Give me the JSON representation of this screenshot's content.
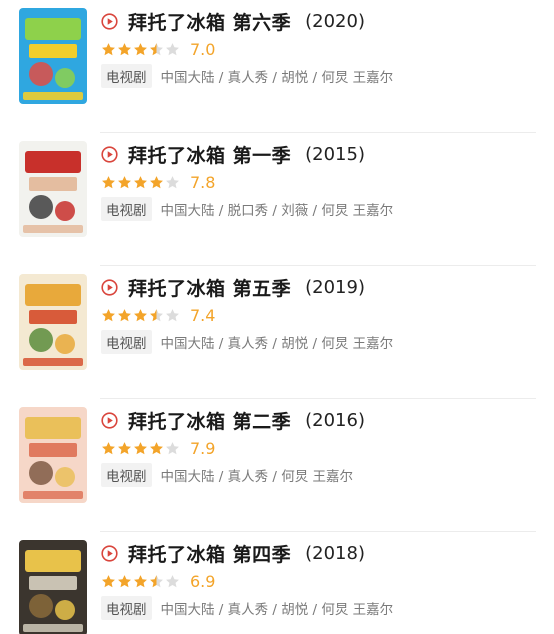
{
  "colors": {
    "accent_red": "#d9453c",
    "star_gold": "#f3a42a",
    "star_empty": "#dcdcdc",
    "meta_gray": "#7a7a7a"
  },
  "items": [
    {
      "title": "拜托了冰箱 第六季",
      "year": "(2020)",
      "rating": "7.0",
      "stars": 3.5,
      "type": "电视剧",
      "meta": "中国大陆 / 真人秀 / 胡悦 / 何炅 王嘉尔",
      "poster_colors": [
        "#2fa7e0",
        "#8ed14b",
        "#f1ce2c",
        "#e24c43"
      ],
      "icon": "play-circle-icon"
    },
    {
      "title": "拜托了冰箱 第一季",
      "year": "(2015)",
      "rating": "7.8",
      "stars": 4,
      "type": "电视剧",
      "meta": "中国大陆 / 脱口秀 / 刘薇 / 何炅 王嘉尔",
      "poster_colors": [
        "#f2f2ee",
        "#c8302b",
        "#e4bda0",
        "#3e3e3e"
      ],
      "icon": "play-circle-icon"
    },
    {
      "title": "拜托了冰箱 第五季",
      "year": "(2019)",
      "rating": "7.4",
      "stars": 3.5,
      "type": "电视剧",
      "meta": "中国大陆 / 真人秀 / 胡悦 / 何炅 王嘉尔",
      "poster_colors": [
        "#f4e9d2",
        "#e8a93b",
        "#d85b3a",
        "#5a8c3c"
      ],
      "icon": "play-circle-icon"
    },
    {
      "title": "拜托了冰箱 第二季",
      "year": "(2016)",
      "rating": "7.9",
      "stars": 4,
      "type": "电视剧",
      "meta": "中国大陆 / 真人秀 / 何炅 王嘉尔",
      "poster_colors": [
        "#f6d7c8",
        "#eac05a",
        "#e07a5f",
        "#7f5a44"
      ],
      "icon": "play-circle-icon"
    },
    {
      "title": "拜托了冰箱 第四季",
      "year": "(2018)",
      "rating": "6.9",
      "stars": 3.5,
      "type": "电视剧",
      "meta": "中国大陆 / 真人秀 / 胡悦 / 何炅 王嘉尔",
      "poster_colors": [
        "#3b352e",
        "#e8c24a",
        "#c9c2b3",
        "#8a6a3a"
      ],
      "icon": "play-circle-icon"
    }
  ]
}
